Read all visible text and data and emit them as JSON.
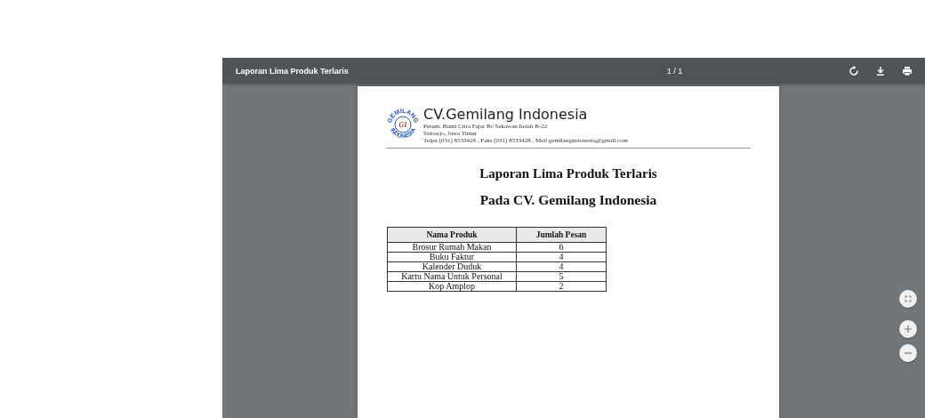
{
  "toolbar": {
    "title": "Laporan Lima Produk Terlaris",
    "page_indicator": "1 / 1"
  },
  "document": {
    "logo": {
      "top_text": "GEMILANG",
      "bottom_text": "INDONESIA",
      "monogram": "GI"
    },
    "company_name": "CV.Gemilang Indonesia",
    "address_lines": [
      "Perum. Bumi Citra Fajar Bc Sekawan Indah B-22",
      "Sidoarjo, Jawa Timur",
      "Telpn (031) 8533428 , Faks (031) 8533428 , Mail gemilangindonesia@gmail.com"
    ],
    "title": "Laporan Lima Produk Terlaris",
    "subtitle": "Pada CV. Gemilang Indonesia",
    "table": {
      "columns": [
        "Nama Produk",
        "Jumlah Pesan"
      ],
      "rows": [
        [
          "Brosur Rumah Makan",
          "6"
        ],
        [
          "Buku Faktur",
          "4"
        ],
        [
          "Kalender Duduk",
          "4"
        ],
        [
          "Kartu Nama Untuk Personal",
          "5"
        ],
        [
          "Kop Amplop",
          "2"
        ]
      ]
    }
  }
}
